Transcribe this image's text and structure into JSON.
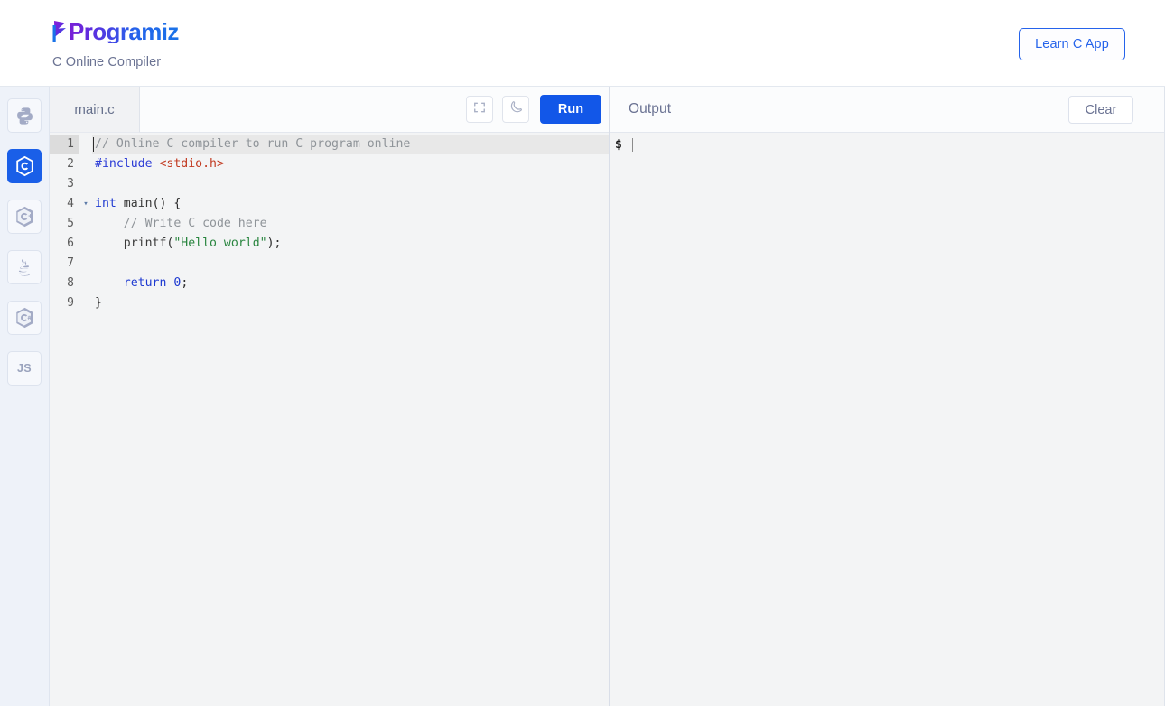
{
  "header": {
    "logo_text": "Programiz",
    "logo_icon": "programiz-arrow-logo",
    "tagline": "C Online Compiler",
    "learn_button_label": "Learn C App",
    "accent_color": "#2563eb",
    "logo_gradient_start": "#7c1fd6",
    "logo_gradient_end": "#1a73e8"
  },
  "sidebar": {
    "items": [
      {
        "name": "python",
        "icon": "python-icon",
        "label": "",
        "active": false
      },
      {
        "name": "c",
        "icon": "c-icon",
        "label": "",
        "active": true
      },
      {
        "name": "cpp",
        "icon": "cpp-icon",
        "label": "",
        "active": false
      },
      {
        "name": "java",
        "icon": "java-icon",
        "label": "",
        "active": false
      },
      {
        "name": "csharp",
        "icon": "csharp-icon",
        "label": "",
        "active": false
      },
      {
        "name": "javascript",
        "icon": "js-icon",
        "label": "JS",
        "active": false
      }
    ],
    "active_color": "#1a5fe8"
  },
  "editor": {
    "tab_label": "main.c",
    "fullscreen_icon": "fullscreen-icon",
    "theme_icon": "moon-icon",
    "run_label": "Run",
    "run_color": "#1257e8",
    "active_line": 1,
    "lines": [
      {
        "n": "1",
        "fold": "",
        "tokens": [
          {
            "t": "comment",
            "v": "// Online C compiler to run C program online"
          }
        ]
      },
      {
        "n": "2",
        "fold": "",
        "tokens": [
          {
            "t": "pre",
            "v": "#include "
          },
          {
            "t": "header",
            "v": "<stdio.h>"
          }
        ]
      },
      {
        "n": "3",
        "fold": "",
        "tokens": []
      },
      {
        "n": "4",
        "fold": "▾",
        "tokens": [
          {
            "t": "kw",
            "v": "int"
          },
          {
            "t": "plain",
            "v": " "
          },
          {
            "t": "fn",
            "v": "main"
          },
          {
            "t": "plain",
            "v": "() {"
          }
        ]
      },
      {
        "n": "5",
        "fold": "",
        "tokens": [
          {
            "t": "comment",
            "v": "    // Write C code here"
          }
        ]
      },
      {
        "n": "6",
        "fold": "",
        "tokens": [
          {
            "t": "plain",
            "v": "    "
          },
          {
            "t": "fn",
            "v": "printf"
          },
          {
            "t": "plain",
            "v": "("
          },
          {
            "t": "str",
            "v": "\"Hello world\""
          },
          {
            "t": "plain",
            "v": ");"
          }
        ]
      },
      {
        "n": "7",
        "fold": "",
        "tokens": []
      },
      {
        "n": "8",
        "fold": "",
        "tokens": [
          {
            "t": "plain",
            "v": "    "
          },
          {
            "t": "kw",
            "v": "return"
          },
          {
            "t": "plain",
            "v": " "
          },
          {
            "t": "num",
            "v": "0"
          },
          {
            "t": "plain",
            "v": ";"
          }
        ]
      },
      {
        "n": "9",
        "fold": "",
        "tokens": [
          {
            "t": "plain",
            "v": "}"
          }
        ]
      }
    ]
  },
  "output": {
    "title": "Output",
    "clear_label": "Clear",
    "prompt": "$",
    "content": ""
  }
}
